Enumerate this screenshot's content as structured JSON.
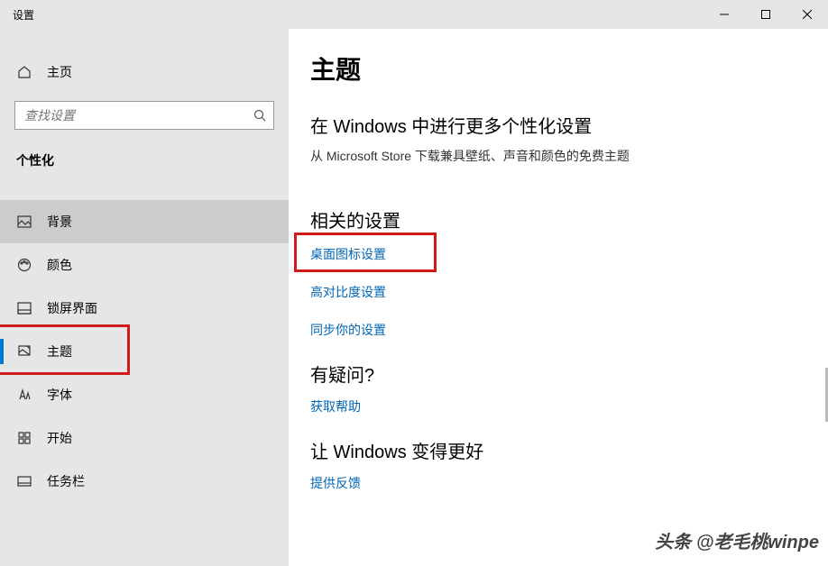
{
  "window": {
    "title": "设置"
  },
  "sidebar": {
    "home_label": "主页",
    "search_placeholder": "查找设置",
    "section_title": "个性化",
    "items": [
      {
        "label": "背景"
      },
      {
        "label": "颜色"
      },
      {
        "label": "锁屏界面"
      },
      {
        "label": "主题"
      },
      {
        "label": "字体"
      },
      {
        "label": "开始"
      },
      {
        "label": "任务栏"
      }
    ]
  },
  "content": {
    "page_title": "主题",
    "personalize_heading": "在 Windows 中进行更多个性化设置",
    "personalize_desc": "从 Microsoft Store 下载兼具壁纸、声音和颜色的免费主题",
    "related_heading": "相关的设置",
    "related_links": [
      "桌面图标设置",
      "高对比度设置",
      "同步你的设置"
    ],
    "question_heading": "有疑问?",
    "question_link": "获取帮助",
    "better_heading": "让 Windows 变得更好",
    "better_link": "提供反馈"
  },
  "watermark": "头条 @老毛桃winpe"
}
